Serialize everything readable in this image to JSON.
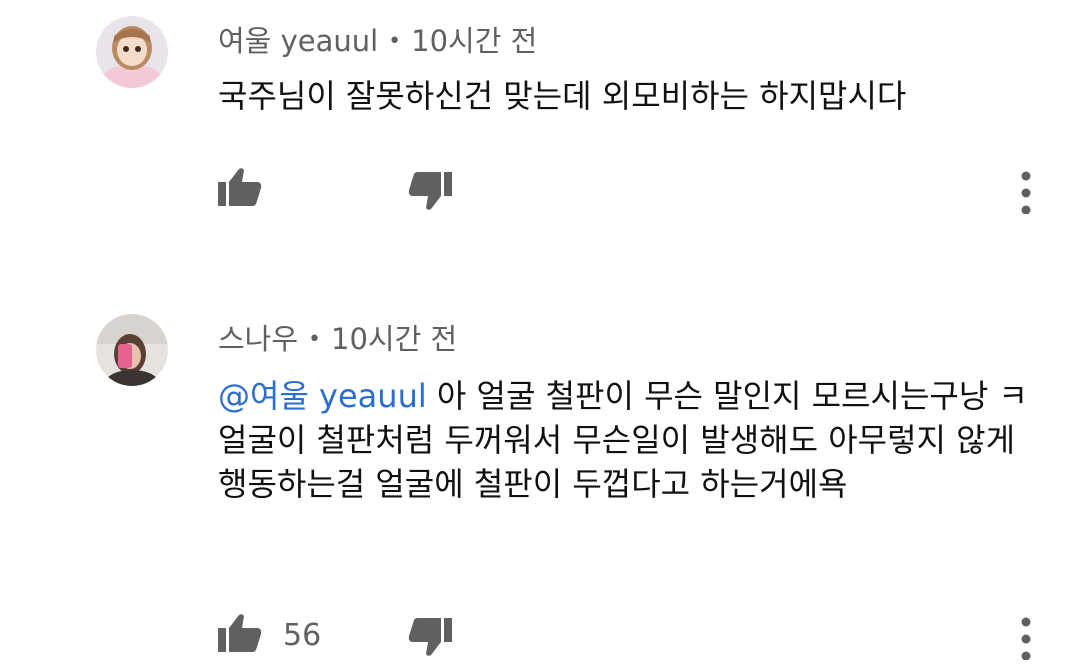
{
  "comments": [
    {
      "author": "여울 yeauul",
      "separator": "•",
      "time": "10시간 전",
      "mention": "",
      "text": "국주님이 잘못하신건 맞는데 외모비하는 하지맙시다",
      "like_count": "",
      "avatar_icon": "doll-avatar-icon"
    },
    {
      "author": "스나우",
      "separator": "•",
      "time": "10시간 전",
      "mention": "@여울 yeauul",
      "text": " 아 얼굴 철판이 무슨 말인지 모르시는구낭 ㅋ 얼굴이 철판처럼 두꺼워서 무슨일이 발생해도 아무렇지 않게 행동하는걸 얼굴에 철판이 두껍다고 하는거에욕",
      "like_count": "56",
      "avatar_icon": "selfie-avatar-icon"
    }
  ],
  "icons": {
    "like": "thumbs-up-icon",
    "dislike": "thumbs-down-icon",
    "more": "more-vertical-icon"
  },
  "colors": {
    "mention": "#2b6dd0",
    "meta_text": "#606060",
    "icon": "#606060"
  }
}
